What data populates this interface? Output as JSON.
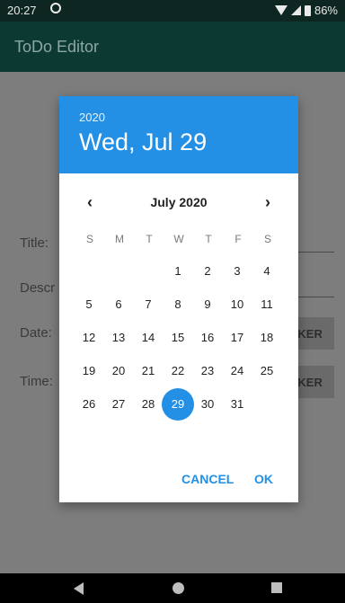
{
  "status": {
    "time": "20:27",
    "battery": "86%"
  },
  "app": {
    "title": "ToDo Editor"
  },
  "form": {
    "title_label": "Title:",
    "desc_label": "Descr",
    "date_label": "Date:",
    "time_label": "Time:",
    "date_btn": "CKER",
    "time_btn": "CKER"
  },
  "dialog": {
    "year": "2020",
    "date": "Wed, Jul 29",
    "month": "July 2020",
    "prev": "‹",
    "next": "›",
    "weekdays": [
      "S",
      "M",
      "T",
      "W",
      "T",
      "F",
      "S"
    ],
    "days": [
      "1",
      "2",
      "3",
      "4",
      "5",
      "6",
      "7",
      "8",
      "9",
      "10",
      "11",
      "12",
      "13",
      "14",
      "15",
      "16",
      "17",
      "18",
      "19",
      "20",
      "21",
      "22",
      "23",
      "24",
      "25",
      "26",
      "27",
      "28",
      "29",
      "30",
      "31"
    ],
    "selected_day": "29",
    "cancel": "CANCEL",
    "ok": "OK",
    "accent": "#2390e6"
  }
}
